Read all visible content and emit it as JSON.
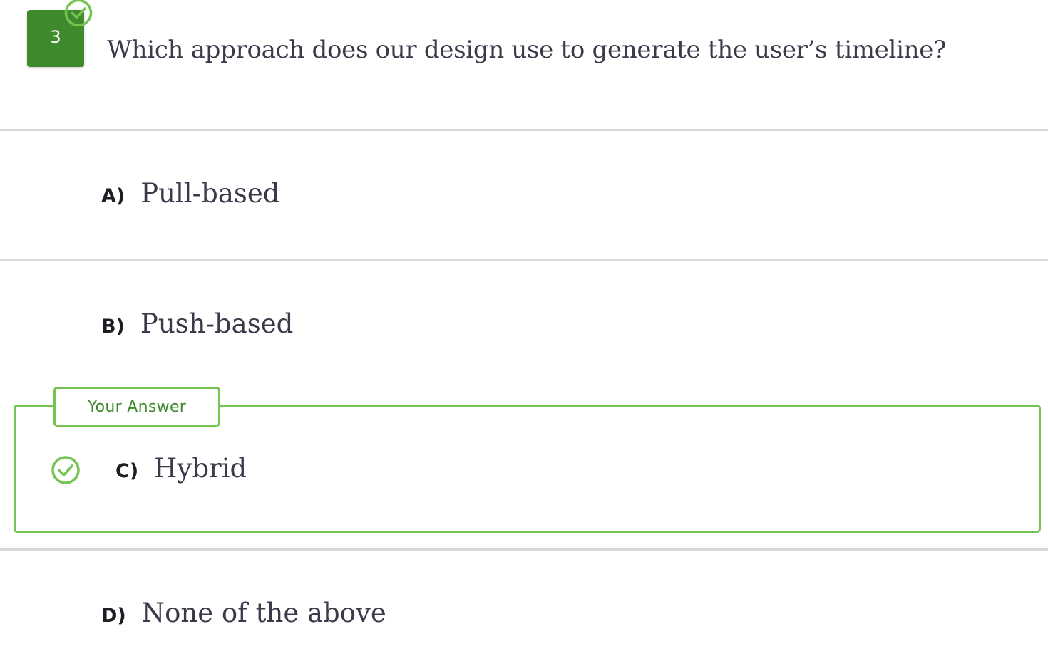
{
  "question": {
    "number": "3",
    "text": "Which approach does our design use to generate the user’s timeline?",
    "status": "correct"
  },
  "options": [
    {
      "letter": "A)",
      "text": "Pull-based"
    },
    {
      "letter": "B)",
      "text": "Push-based"
    },
    {
      "letter": "C)",
      "text": "Hybrid",
      "selected": true,
      "correct": true
    },
    {
      "letter": "D)",
      "text": "None of the above"
    }
  ],
  "answer_label": "Your Answer",
  "colors": {
    "badge": "#3f8a2c",
    "correct_accent": "#74c452",
    "divider": "#d6d7d9",
    "text": "#3b3a4a"
  },
  "icons": {
    "badge_status": "check-circle-icon",
    "selected_status": "check-circle-icon"
  }
}
